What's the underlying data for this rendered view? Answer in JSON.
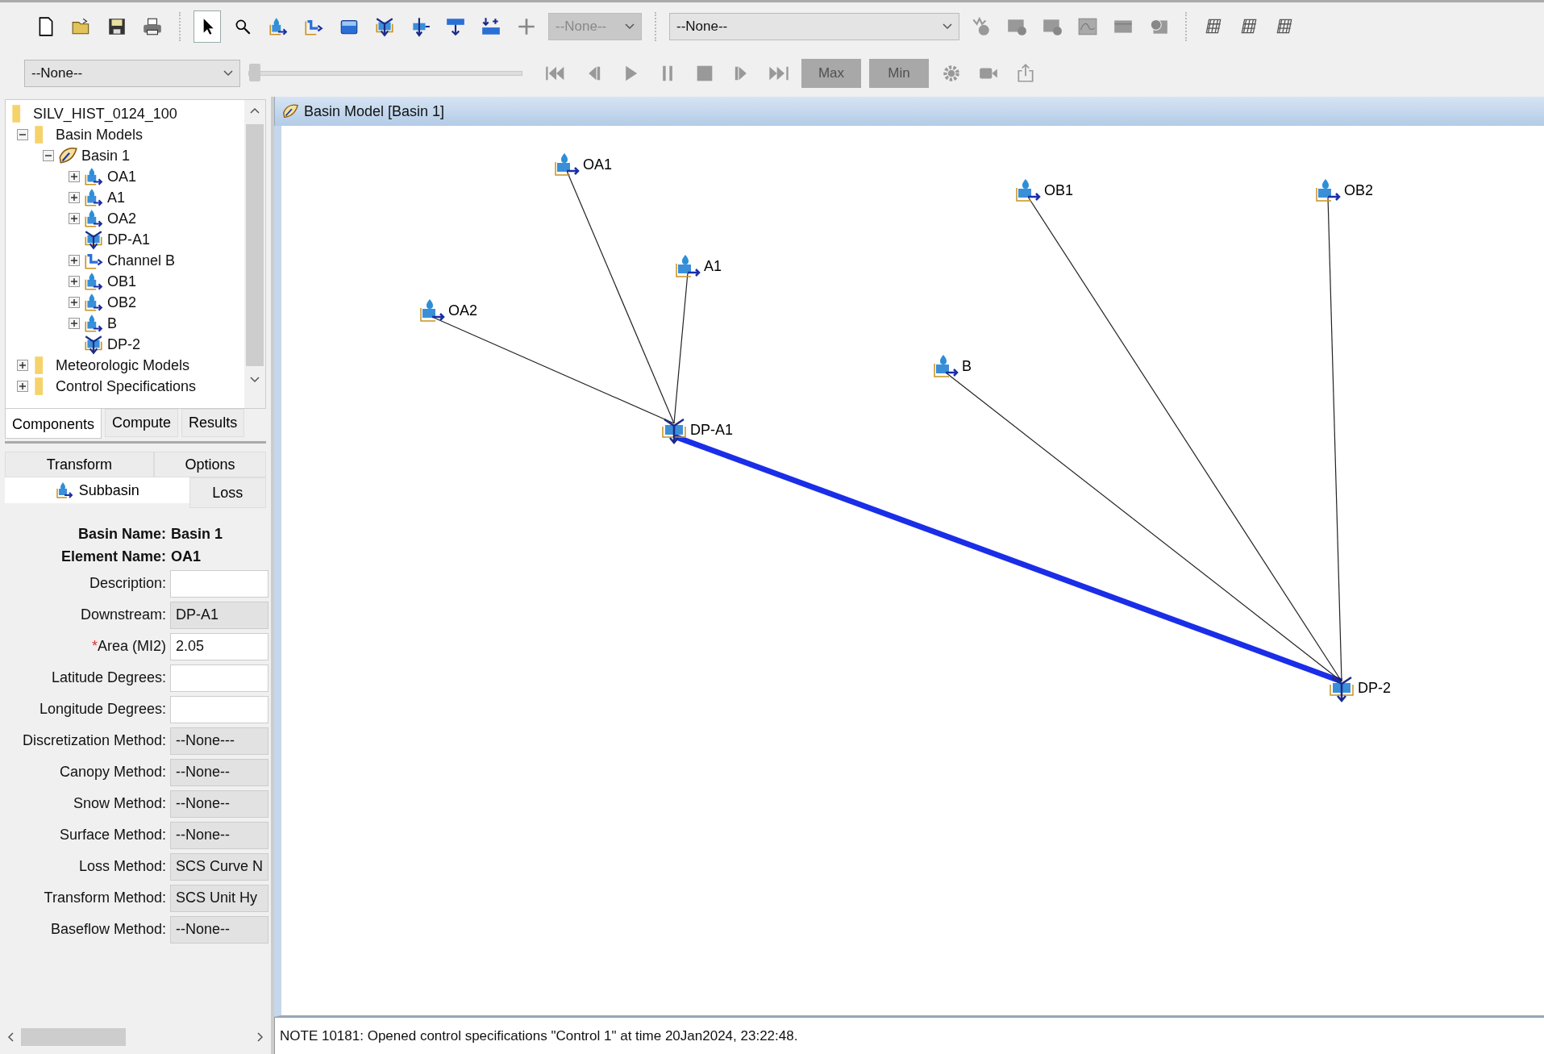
{
  "toolbar": {
    "tools": [
      {
        "kind": "new",
        "selected": false
      },
      {
        "kind": "open",
        "selected": false
      },
      {
        "kind": "save",
        "selected": false
      },
      {
        "kind": "print",
        "selected": false
      },
      {
        "kind": "pointer",
        "selected": true
      },
      {
        "kind": "zoom",
        "selected": false
      },
      {
        "kind": "subbasin",
        "selected": false
      },
      {
        "kind": "reach",
        "selected": false
      },
      {
        "kind": "reservoir",
        "selected": false
      },
      {
        "kind": "junction",
        "selected": false
      },
      {
        "kind": "diversion",
        "selected": false
      },
      {
        "kind": "source",
        "selected": false
      },
      {
        "kind": "sink",
        "selected": false
      },
      {
        "kind": "cross",
        "selected": false
      }
    ],
    "element_combo": {
      "value": "--None--",
      "disabled": true
    },
    "run_combo": {
      "value": "--None--",
      "disabled": false
    },
    "result_tools": [
      {
        "kind": "summary"
      },
      {
        "kind": "graph"
      },
      {
        "kind": "graph"
      },
      {
        "kind": "chart"
      },
      {
        "kind": "table"
      },
      {
        "kind": "time"
      }
    ],
    "grid_tools": [
      {
        "kind": "grid"
      },
      {
        "kind": "grid"
      },
      {
        "kind": "grid"
      }
    ],
    "animation_combo": {
      "value": "--None--"
    },
    "slider": {
      "level": 0
    },
    "playback": [
      {
        "kind": "first"
      },
      {
        "kind": "back"
      },
      {
        "kind": "play"
      },
      {
        "kind": "pause"
      },
      {
        "kind": "stop"
      },
      {
        "kind": "step"
      },
      {
        "kind": "last"
      }
    ],
    "max_button": {
      "label": "Max",
      "disabled": true
    },
    "min_button": {
      "label": "Min",
      "disabled": true
    },
    "extra_tools": [
      {
        "kind": "gear"
      },
      {
        "kind": "camera"
      },
      {
        "kind": "export"
      }
    ]
  },
  "tree": [
    {
      "label": "SILV_HIST_0124_100",
      "kind": "folder",
      "children": [
        {
          "label": "Basin Models",
          "kind": "folder",
          "expanded": true,
          "children": [
            {
              "label": "Basin 1",
              "kind": "basin",
              "expanded": true,
              "children": [
                {
                  "label": "OA1",
                  "kind": "subbasin",
                  "expanded": false
                },
                {
                  "label": "A1",
                  "kind": "subbasin",
                  "expanded": false
                },
                {
                  "label": "OA2",
                  "kind": "subbasin",
                  "expanded": false
                },
                {
                  "label": "DP-A1",
                  "kind": "junction"
                },
                {
                  "label": "Channel B",
                  "kind": "reach",
                  "expanded": false
                },
                {
                  "label": "OB1",
                  "kind": "subbasin",
                  "expanded": false
                },
                {
                  "label": "OB2",
                  "kind": "subbasin",
                  "expanded": false
                },
                {
                  "label": "B",
                  "kind": "subbasin",
                  "expanded": false
                },
                {
                  "label": "DP-2",
                  "kind": "junction"
                }
              ]
            }
          ]
        },
        {
          "label": "Meteorologic Models",
          "kind": "folder",
          "expanded": false
        },
        {
          "label": "Control Specifications",
          "kind": "folder",
          "expanded": false
        }
      ]
    }
  ],
  "explorer_tabs": [
    {
      "label": "Components",
      "selected": true
    },
    {
      "label": "Compute",
      "selected": false
    },
    {
      "label": "Results",
      "selected": false
    }
  ],
  "property_tabs": {
    "back_row": [
      {
        "label": "Transform",
        "selected": false
      },
      {
        "label": "Options",
        "selected": false
      }
    ],
    "front_row": [
      {
        "label": "Subbasin",
        "selected": true
      },
      {
        "label": "Loss",
        "selected": false
      }
    ]
  },
  "form": {
    "basin_name": {
      "label": "Basin Name:",
      "value": "Basin 1"
    },
    "element_name": {
      "label": "Element Name:",
      "value": "OA1"
    },
    "fields": [
      {
        "label": "Description:",
        "kind": "text"
      },
      {
        "label": "Downstream:",
        "value": "DP-A1",
        "kind": "choice"
      },
      {
        "label": "Area (MI2)",
        "value": "2.05",
        "kind": "text",
        "required_mark": "*"
      },
      {
        "label": "Latitude Degrees:",
        "kind": "text"
      },
      {
        "label": "Longitude Degrees:",
        "kind": "text"
      },
      {
        "label": "Discretization Method:",
        "value": "--None---",
        "kind": "choice"
      },
      {
        "label": "Canopy Method:",
        "value": "--None--",
        "kind": "choice"
      },
      {
        "label": "Snow Method:",
        "value": "--None--",
        "kind": "choice"
      },
      {
        "label": "Surface Method:",
        "value": "--None--",
        "kind": "choice"
      },
      {
        "label": "Loss Method:",
        "value": "SCS Curve N",
        "kind": "choice"
      },
      {
        "label": "Transform Method:",
        "value": "SCS Unit Hy",
        "kind": "choice"
      },
      {
        "label": "Baseflow Method:",
        "value": "--None--",
        "kind": "choice"
      }
    ]
  },
  "basin_window": {
    "title": "Basin Model [Basin 1]",
    "elements": [
      {
        "label": "OA1",
        "kind": "subbasin"
      },
      {
        "label": "A1",
        "kind": "subbasin"
      },
      {
        "label": "OA2",
        "kind": "subbasin"
      },
      {
        "label": "DP-A1",
        "kind": "junction"
      },
      {
        "label": "OB1",
        "kind": "subbasin"
      },
      {
        "label": "OB2",
        "kind": "subbasin"
      },
      {
        "label": "B",
        "kind": "subbasin"
      },
      {
        "label": "DP-2",
        "kind": "junction"
      }
    ],
    "links": [
      {
        "kind": "connector"
      },
      {
        "kind": "connector"
      },
      {
        "kind": "connector"
      },
      {
        "kind": "reach"
      },
      {
        "kind": "connector"
      },
      {
        "kind": "connector"
      },
      {
        "kind": "connector"
      }
    ]
  },
  "message_log": {
    "message": "NOTE 10181:  Opened control specifications \"Control 1\" at time 20Jan2024, 23:22:48."
  }
}
